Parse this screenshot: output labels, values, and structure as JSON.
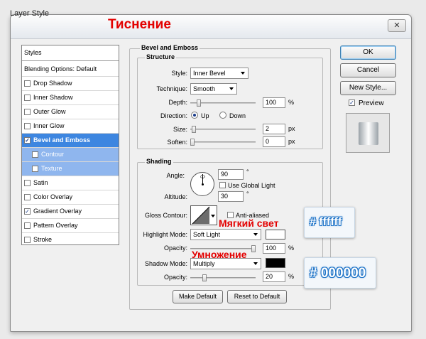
{
  "window": {
    "title": "Layer Style",
    "close_label": "✕"
  },
  "annotations": {
    "title_ru": "Тиснение",
    "highlight_ru": "Мягкий свет",
    "shadow_ru": "Умножение"
  },
  "sidebar": {
    "styles_label": "Styles",
    "blending_label": "Blending Options: Default",
    "items": [
      {
        "label": "Drop Shadow",
        "checked": false
      },
      {
        "label": "Inner Shadow",
        "checked": false
      },
      {
        "label": "Outer Glow",
        "checked": false
      },
      {
        "label": "Inner Glow",
        "checked": false
      },
      {
        "label": "Bevel and Emboss",
        "checked": true
      },
      {
        "label": "Contour",
        "checked": false
      },
      {
        "label": "Texture",
        "checked": false
      },
      {
        "label": "Satin",
        "checked": false
      },
      {
        "label": "Color Overlay",
        "checked": false
      },
      {
        "label": "Gradient Overlay",
        "checked": true
      },
      {
        "label": "Pattern Overlay",
        "checked": false
      },
      {
        "label": "Stroke",
        "checked": false
      }
    ]
  },
  "panel": {
    "title": "Bevel and Emboss",
    "structure": {
      "title": "Structure",
      "style_label": "Style:",
      "style_value": "Inner Bevel",
      "technique_label": "Technique:",
      "technique_value": "Smooth",
      "depth_label": "Depth:",
      "depth_value": "100",
      "depth_unit": "%",
      "direction_label": "Direction:",
      "dir_up": "Up",
      "dir_down": "Down",
      "size_label": "Size:",
      "size_value": "2",
      "size_unit": "px",
      "soften_label": "Soften:",
      "soften_value": "0",
      "soften_unit": "px"
    },
    "shading": {
      "title": "Shading",
      "angle_label": "Angle:",
      "angle_value": "90",
      "angle_unit": "°",
      "global_light_label": "Use Global Light",
      "global_light_checked": false,
      "altitude_label": "Altitude:",
      "altitude_value": "30",
      "altitude_unit": "°",
      "gloss_label": "Gloss Contour:",
      "anti_aliased_label": "Anti-aliased",
      "anti_aliased_checked": false,
      "highlight_label": "Highlight Mode:",
      "highlight_value": "Soft Light",
      "highlight_color": "#ffffff",
      "hl_opacity_label": "Opacity:",
      "hl_opacity_value": "100",
      "hl_opacity_unit": "%",
      "shadow_label": "Shadow Mode:",
      "shadow_value": "Multiply",
      "shadow_color": "#000000",
      "sh_opacity_label": "Opacity:",
      "sh_opacity_value": "20",
      "sh_opacity_unit": "%"
    },
    "make_default": "Make Default",
    "reset_default": "Reset to Default"
  },
  "buttons": {
    "ok": "OK",
    "cancel": "Cancel",
    "new_style": "New Style...",
    "preview": "Preview",
    "preview_checked": true
  },
  "callouts": {
    "white_hex": "# ffffff",
    "black_hex": "# 000000"
  },
  "sliders": {
    "depth": 0.1,
    "size": 0.02,
    "soften": 0.0,
    "hl_opacity": 1.0,
    "sh_opacity": 0.2
  }
}
